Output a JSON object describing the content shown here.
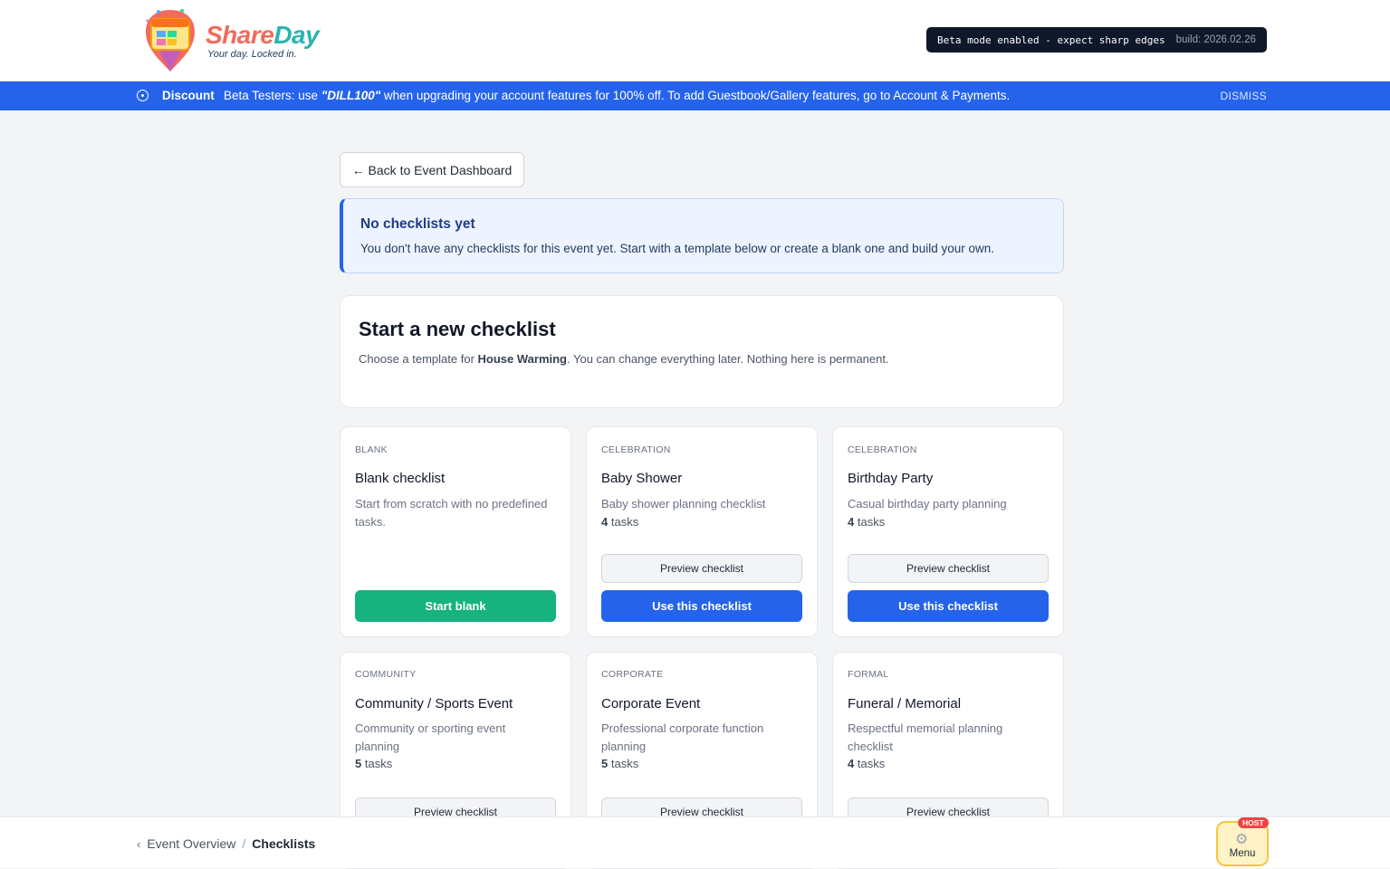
{
  "header": {
    "logo_word_a": "Share",
    "logo_word_b": "Day",
    "logo_tagline": "Your day. Locked in.",
    "beta_message": "Beta mode enabled - expect sharp edges",
    "build": "build: 2026.02.26"
  },
  "banner": {
    "title": "Discount",
    "text_before": "Beta Testers: use ",
    "code": "\"DILL100\"",
    "text_after": " when upgrading your account features for 100% off. To add Guestbook/Gallery features, go to Account & Payments.",
    "dismiss": "DISMISS"
  },
  "back_button": "← Back to Event Dashboard",
  "info": {
    "title": "No checklists yet",
    "text": "You don't have any checklists for this event yet. Start with a template below or create a blank one and build your own."
  },
  "intro": {
    "title": "Start a new checklist",
    "text_before": "Choose a template for ",
    "event_name": "House Warming",
    "text_after": ". You can change everything later. Nothing here is permanent."
  },
  "templates": [
    {
      "category": "BLANK",
      "name": "Blank checklist",
      "description": "Start from scratch with no predefined tasks.",
      "primary": "Start blank"
    },
    {
      "category": "CELEBRATION",
      "name": "Baby Shower",
      "description": "Baby shower planning checklist",
      "task_count": "4",
      "tasks_word": " tasks",
      "preview": "Preview checklist",
      "primary": "Use this checklist"
    },
    {
      "category": "CELEBRATION",
      "name": "Birthday Party",
      "description": "Casual birthday party planning",
      "task_count": "4",
      "tasks_word": " tasks",
      "preview": "Preview checklist",
      "primary": "Use this checklist"
    },
    {
      "category": "COMMUNITY",
      "name": "Community / Sports Event",
      "description": "Community or sporting event planning",
      "task_count": "5",
      "tasks_word": " tasks",
      "preview": "Preview checklist"
    },
    {
      "category": "CORPORATE",
      "name": "Corporate Event",
      "description": "Professional corporate function planning",
      "task_count": "5",
      "tasks_word": " tasks",
      "preview": "Preview checklist"
    },
    {
      "category": "FORMAL",
      "name": "Funeral / Memorial",
      "description": "Respectful memorial planning checklist",
      "task_count": "4",
      "tasks_word": " tasks",
      "preview": "Preview checklist"
    }
  ],
  "footer": {
    "crumb_chevron": "‹",
    "crumb_parent": "Event Overview",
    "crumb_sep": "/",
    "crumb_current": "Checklists",
    "menu_label": "Menu",
    "host_badge": "HOST",
    "menu_icon": "gear-icon"
  },
  "colors": {
    "primary_blue": "#2563eb",
    "green": "#16b37e",
    "banner": "#2563eb",
    "beta_bg": "#0f172a",
    "menu_bg": "#fef3c7"
  }
}
